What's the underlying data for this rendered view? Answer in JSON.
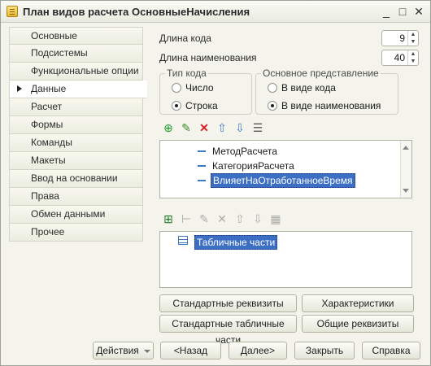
{
  "window": {
    "title": "План видов расчета ОсновныеНачисления",
    "controls": {
      "minimize": "_",
      "maximize": "□",
      "close": "✕"
    }
  },
  "sidebar": {
    "items": [
      {
        "label": "Основные"
      },
      {
        "label": "Подсистемы"
      },
      {
        "label": "Функциональные опции"
      },
      {
        "label": "Данные",
        "active": true
      },
      {
        "label": "Расчет"
      },
      {
        "label": "Формы"
      },
      {
        "label": "Команды"
      },
      {
        "label": "Макеты"
      },
      {
        "label": "Ввод на основании"
      },
      {
        "label": "Права"
      },
      {
        "label": "Обмен данными"
      },
      {
        "label": "Прочее"
      }
    ]
  },
  "main": {
    "code_length": {
      "label": "Длина кода",
      "value": "9"
    },
    "name_length": {
      "label": "Длина наименования",
      "value": "40"
    },
    "code_type": {
      "legend": "Тип кода",
      "options": [
        "Число",
        "Строка"
      ],
      "selected": "Строка"
    },
    "main_presentation": {
      "legend": "Основное представление",
      "options": [
        "В виде кода",
        "В виде наименования"
      ],
      "selected": "В виде наименования"
    },
    "attributes": {
      "toolbar": [
        "add-icon",
        "edit-icon",
        "delete-icon",
        "move-up-icon",
        "move-down-icon",
        "list-icon"
      ],
      "items": [
        "МетодРасчета",
        "КатегорияРасчета",
        "ВлияетНаОтработанноеВремя"
      ],
      "selected_index": 2
    },
    "tabular_sections": {
      "toolbar": [
        "add-table-icon",
        "add-column-icon",
        "edit-icon",
        "delete-icon",
        "move-up-icon",
        "move-down-icon",
        "list-icon"
      ],
      "items": [
        "Табличные части"
      ]
    },
    "buttons": {
      "standard_attributes": "Стандартные реквизиты",
      "characteristics": "Характеристики",
      "standard_tabular_sections": "Стандартные табличные части",
      "common_attributes": "Общие реквизиты"
    }
  },
  "footer": {
    "actions": "Действия",
    "back": "<Назад",
    "next": "Далее>",
    "close": "Закрыть",
    "help": "Справка"
  },
  "colors": {
    "selection": "#3c6fc3",
    "accent_icon": "#3b78c0"
  }
}
